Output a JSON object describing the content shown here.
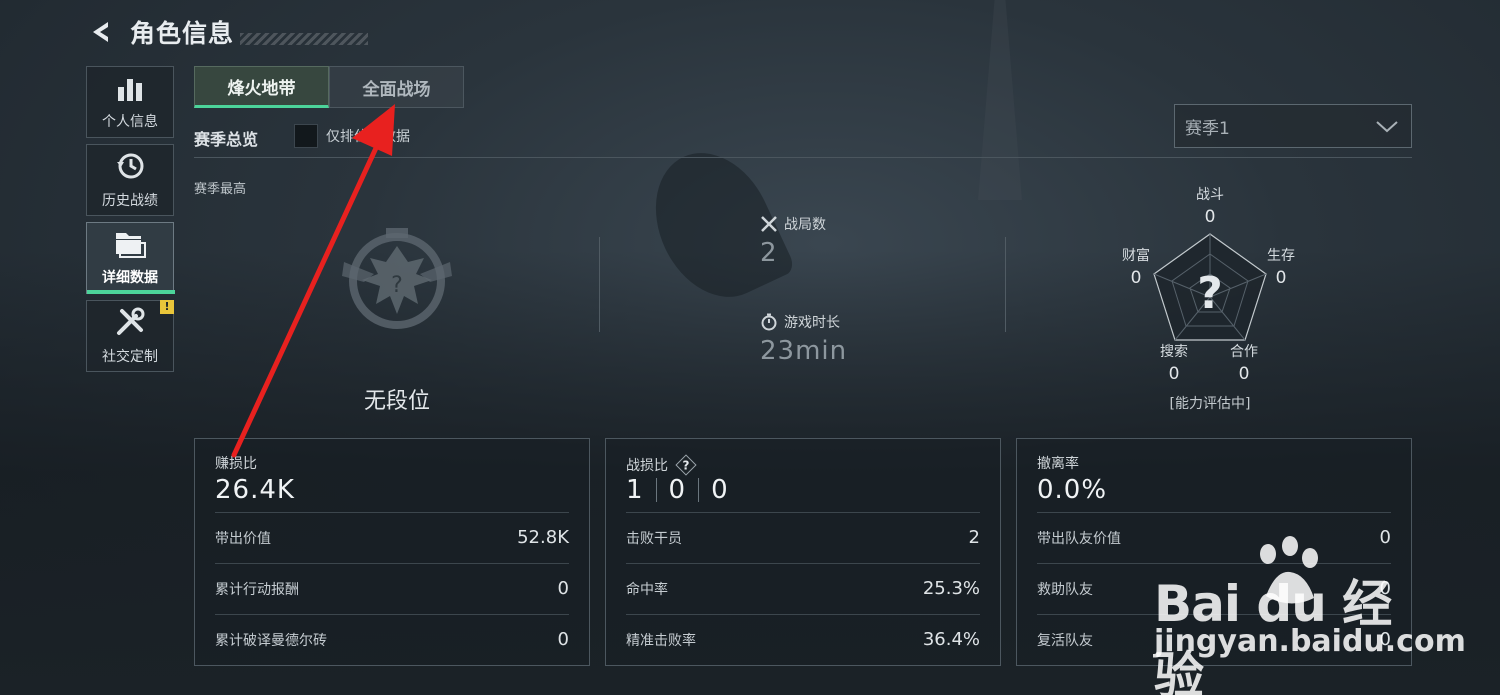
{
  "header": {
    "title": "角色信息",
    "back_icon": "back-arrow-icon"
  },
  "sidebar": {
    "items": [
      {
        "label": "个人信息",
        "icon": "bar-chart-icon",
        "active": false
      },
      {
        "label": "历史战绩",
        "icon": "history-clock-icon",
        "active": false
      },
      {
        "label": "详细数据",
        "icon": "folder-icon",
        "active": true
      },
      {
        "label": "社交定制",
        "icon": "tools-icon",
        "active": false,
        "badge": "!"
      }
    ]
  },
  "tabs": [
    {
      "label": "烽火地带",
      "active": true
    },
    {
      "label": "全面战场",
      "active": false
    }
  ],
  "overview": {
    "title": "赛季总览",
    "checkbox_label": "仅排位赛数据",
    "checkbox_checked": false,
    "season_select": "赛季1",
    "season_best": "赛季最高",
    "rank_text": "无段位"
  },
  "stats": {
    "matches_label": "战局数",
    "matches_value": "2",
    "playtime_label": "游戏时长",
    "playtime_value": "23min"
  },
  "radar": {
    "axes": [
      {
        "label": "战斗",
        "value": "0"
      },
      {
        "label": "生存",
        "value": "0"
      },
      {
        "label": "合作",
        "value": "0"
      },
      {
        "label": "搜索",
        "value": "0"
      },
      {
        "label": "财富",
        "value": "0"
      }
    ],
    "center": "?",
    "note": "[能力评估中]"
  },
  "cards": [
    {
      "title": "赚损比",
      "big": "26.4K",
      "rows": [
        {
          "k": "带出价值",
          "v": "52.8K"
        },
        {
          "k": "累计行动报酬",
          "v": "0"
        },
        {
          "k": "累计破译曼德尔砖",
          "v": "0"
        }
      ]
    },
    {
      "title": "战损比",
      "big_parts": [
        "1",
        "0",
        "0"
      ],
      "help": "?",
      "rows": [
        {
          "k": "击败干员",
          "v": "2"
        },
        {
          "k": "命中率",
          "v": "25.3%"
        },
        {
          "k": "精准击败率",
          "v": "36.4%"
        }
      ]
    },
    {
      "title": "撤离率",
      "big": "0.0%",
      "rows": [
        {
          "k": "带出队友价值",
          "v": "0"
        },
        {
          "k": "救助队友",
          "v": "0"
        },
        {
          "k": "复活队友",
          "v": "0"
        }
      ]
    }
  ],
  "watermark": {
    "main": "Bai du 经验",
    "sub": "jingyan.baidu.com"
  },
  "colors": {
    "accent": "#4cd49a",
    "badge": "#e9c53a",
    "arrow": "#e8211f"
  }
}
